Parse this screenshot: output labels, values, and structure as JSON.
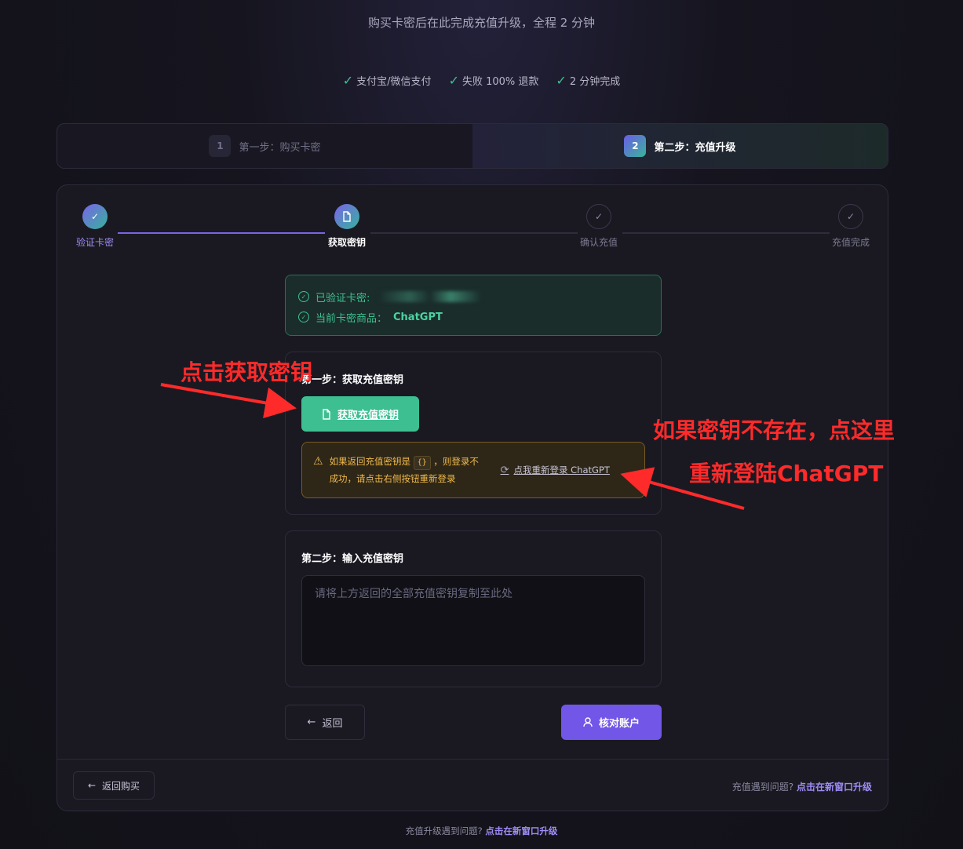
{
  "header": {
    "subtitle": "购买卡密后在此完成充值升级，全程 2 分钟",
    "features": [
      "支付宝/微信支付",
      "失败 100% 退款",
      "2 分钟完成"
    ]
  },
  "step_tabs": [
    {
      "num": "1",
      "label": "第一步：购买卡密"
    },
    {
      "num": "2",
      "label": "第二步：充值升级"
    }
  ],
  "progress": {
    "steps": [
      {
        "label": "验证卡密",
        "state": "done"
      },
      {
        "label": "获取密钥",
        "state": "current"
      },
      {
        "label": "确认充值",
        "state": "todo"
      },
      {
        "label": "充值完成",
        "state": "todo"
      }
    ]
  },
  "verified": {
    "card_label": "已验证卡密:",
    "product_label": "当前卡密商品：",
    "product_value": "ChatGPT"
  },
  "step1": {
    "title": "第一步：获取充值密钥",
    "button": "获取充值密钥",
    "warning_pre": "如果返回充值密钥是",
    "warning_code": "{}",
    "warning_post": "，则登录不成功，请点击右侧按钮重新登录",
    "relogin": "点我重新登录 ChatGPT"
  },
  "step2": {
    "title": "第二步：输入充值密钥",
    "placeholder": "请将上方返回的全部充值密钥复制至此处"
  },
  "actions": {
    "back": "返回",
    "verify": "核对账户"
  },
  "footer": {
    "back_buy": "返回购买",
    "help_text": "充值遇到问题?",
    "help_link": "点击在新窗口升级",
    "bottom_text": "充值升级遇到问题?",
    "bottom_link": "点击在新窗口升级"
  },
  "annotations": {
    "a1": "点击获取密钥",
    "a2": "如果密钥不存在，点这里",
    "a3": "重新登陆ChatGPT"
  },
  "colors": {
    "accent_purple": "#7256e8",
    "accent_green": "#3dbf92",
    "warning": "#f0b84a",
    "annotation_red": "#ff2a2a"
  }
}
